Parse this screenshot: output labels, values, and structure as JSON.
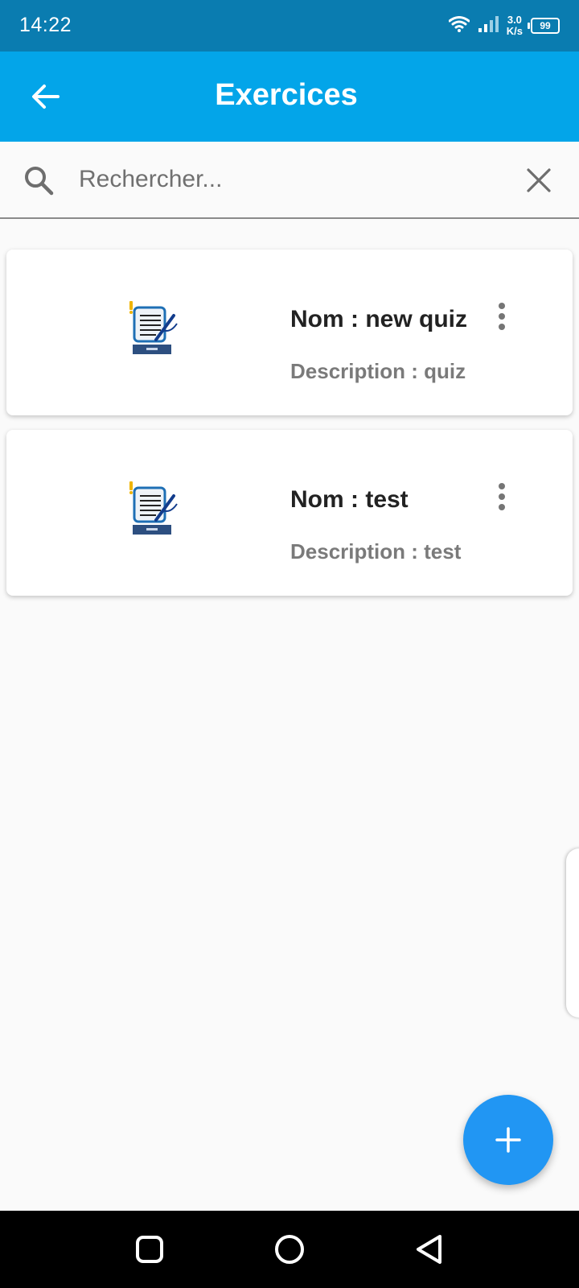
{
  "status_bar": {
    "time": "14:22",
    "speed_value": "3.0",
    "speed_unit": "K/s",
    "battery": "99"
  },
  "app_bar": {
    "title": "Exercices",
    "back_icon": "arrow-left-icon"
  },
  "search": {
    "placeholder": "Rechercher...",
    "value": "",
    "search_icon": "search-icon",
    "clear_icon": "close-icon"
  },
  "exercises": [
    {
      "name": "Nom : new quiz",
      "description": "Description : quiz",
      "thumbnail_icon": "quiz-document-icon",
      "menu_icon": "more-vertical-icon"
    },
    {
      "name": "Nom : test",
      "description": "Description : test",
      "thumbnail_icon": "quiz-document-icon",
      "menu_icon": "more-vertical-icon"
    }
  ],
  "fab": {
    "icon": "plus-icon"
  },
  "navigation": {
    "recents_icon": "square-icon",
    "home_icon": "circle-icon",
    "back_icon": "triangle-back-icon"
  },
  "colors": {
    "status_bar": "#0a7cb0",
    "app_bar": "#03a5e9",
    "fab": "#2196f3",
    "background": "#fafafa",
    "card": "#ffffff"
  }
}
